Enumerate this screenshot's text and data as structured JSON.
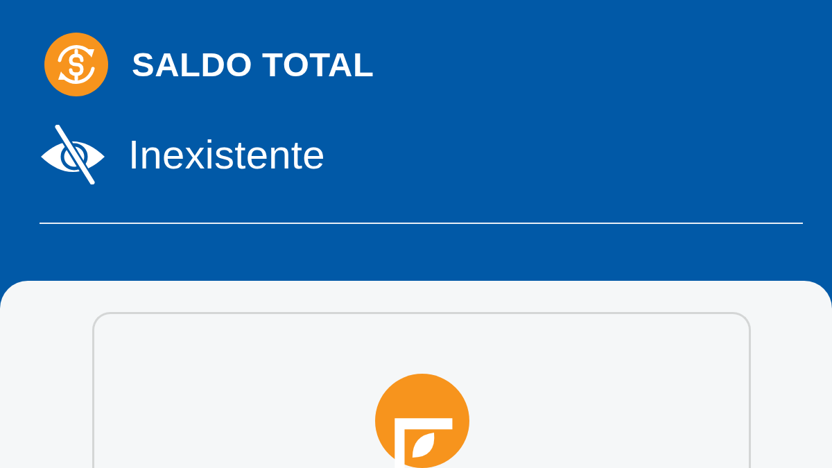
{
  "balance": {
    "title": "SALDO TOTAL",
    "value": "Inexistente",
    "hidden": true
  }
}
